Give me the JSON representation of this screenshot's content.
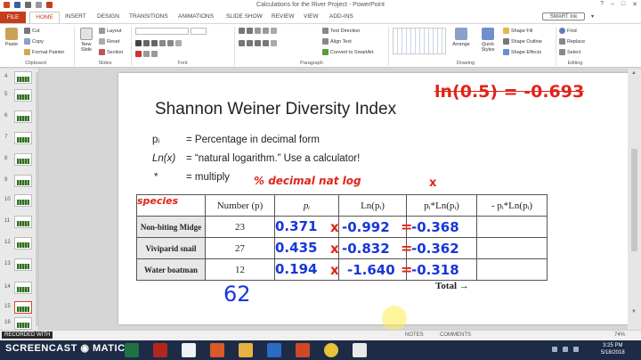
{
  "window": {
    "title": "Calculations for the River Project - PowerPoint",
    "controls": [
      "?",
      "–",
      "□",
      "✕"
    ]
  },
  "tabs": [
    "FILE",
    "HOME",
    "INSERT",
    "DESIGN",
    "TRANSITIONS",
    "ANIMATIONS",
    "SLIDE SHOW",
    "REVIEW",
    "VIEW",
    "ADD-INS"
  ],
  "smart_ink": "SMART Ink",
  "ribbon": {
    "clipboard": {
      "label": "Clipboard",
      "paste": "Paste",
      "cut": "Cut",
      "copy": "Copy",
      "format_painter": "Format Painter"
    },
    "slides": {
      "label": "Slides",
      "new_slide": "New Slide",
      "layout": "Layout",
      "reset": "Reset",
      "section": "Section"
    },
    "font": {
      "label": "Font"
    },
    "paragraph": {
      "label": "Paragraph",
      "text_direction": "Text Direction",
      "align_text": "Align Text",
      "convert": "Convert to SmartArt"
    },
    "drawing": {
      "label": "Drawing",
      "arrange": "Arrange",
      "quick_styles": "Quick Styles",
      "shape_fill": "Shape Fill",
      "shape_outline": "Shape Outline",
      "shape_effects": "Shape Effects"
    },
    "editing": {
      "label": "Editing",
      "find": "Find",
      "replace": "Replace",
      "select": "Select"
    }
  },
  "thumbnails": [
    "4",
    "5",
    "6",
    "7",
    "8",
    "9",
    "10",
    "11",
    "12",
    "13",
    "14",
    "15",
    "16"
  ],
  "slide": {
    "title": "Shannon Weiner Diversity Index",
    "defs": [
      {
        "sym": "pᵢ",
        "text": "= Percentage in decimal form"
      },
      {
        "sym": "Ln(x)",
        "text": "= “natural logarithm.”  Use a calculator!"
      },
      {
        "sym": "*",
        "text": "= multiply"
      }
    ],
    "table": {
      "headers": [
        "",
        "Number (p)",
        "pᵢ",
        "Ln(pᵢ)",
        "pᵢ*Ln(pᵢ)",
        "- pᵢ*Ln(pᵢ)"
      ],
      "rows": [
        {
          "species": "Non-biting Midge",
          "number": "23"
        },
        {
          "species": "Viviparid snail",
          "number": "27"
        },
        {
          "species": "Water boatman",
          "number": "12"
        }
      ]
    },
    "total": "Total →",
    "ink": {
      "top_right": "ln(0.5) = -0.693",
      "species": "species",
      "header_note": "% decimal  nat log",
      "header_x": "x",
      "pi": [
        "0.371",
        "0.435",
        "0.194"
      ],
      "ln": [
        "-0.992",
        "-0.832",
        "-1.640"
      ],
      "prod": [
        "-0.368",
        "-0.362",
        "-0.318"
      ],
      "xs": [
        "x",
        "x",
        "x"
      ],
      "eqs": [
        "=",
        "=",
        "="
      ],
      "sum": "62"
    }
  },
  "status": {
    "recorded": "RECORDED WITH",
    "notes": "NOTES",
    "comments": "COMMENTS",
    "zoom": "74%"
  },
  "taskbar": {
    "brand": "SCREENCAST ◉ MATIC",
    "time": "3:25 PM",
    "date": "5/18/2018"
  },
  "colors": {
    "accent": "#c43e1c",
    "ink_blue": "#1638d8",
    "ink_red": "#e0241a",
    "taskbar": "#1e2b46"
  }
}
